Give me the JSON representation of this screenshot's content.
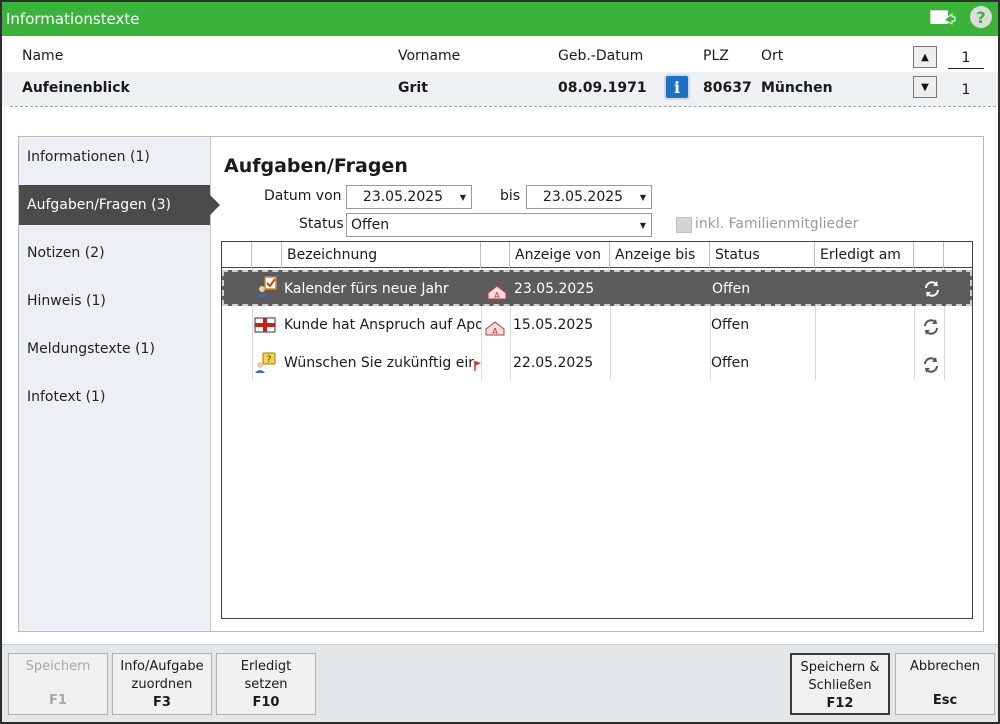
{
  "window": {
    "title": "Informationstexte"
  },
  "titlebar": {
    "exit_icon": "exit-window-icon",
    "help_icon": "help-icon",
    "help_glyph": "?"
  },
  "patient": {
    "labels": {
      "name": "Name",
      "vorname": "Vorname",
      "geb": "Geb.-Datum",
      "plz": "PLZ",
      "ort": "Ort"
    },
    "values": {
      "name": "Aufeinenblick",
      "vorname": "Grit",
      "geb": "08.09.1971",
      "plz": "80637",
      "ort": "München"
    },
    "info_glyph": "i",
    "pager": {
      "current": "1",
      "total": "1"
    }
  },
  "sidebar": {
    "items": [
      {
        "label": "Informationen (1)"
      },
      {
        "label": "Aufgaben/Fragen (3)",
        "active": true
      },
      {
        "label": "Notizen (2)"
      },
      {
        "label": "Hinweis (1)"
      },
      {
        "label": "Meldungstexte (1)"
      },
      {
        "label": "Infotext (1)"
      }
    ]
  },
  "content": {
    "title": "Aufgaben/Fragen",
    "filters": {
      "datum_von_label": "Datum von",
      "datum_von": "23.05.2025",
      "bis_label": "bis",
      "bis": "23.05.2025",
      "status_label": "Status",
      "status": "Offen",
      "family_label": "inkl. Familienmitglieder"
    },
    "table": {
      "headers": [
        "",
        "",
        "Bezeichnung",
        "",
        "Anzeige von",
        "Anzeige bis",
        "Status",
        "Erledigt am",
        ""
      ],
      "rows": [
        {
          "bezeichnung": "Kalender fürs neue Jahr",
          "anzeige_von": "23.05.2025",
          "anzeige_bis": "",
          "status": "Offen",
          "erledigt_am": "",
          "icon": "task-person-icon",
          "selected": true
        },
        {
          "bezeichnung": "Kunde hat Anspruch auf Apot",
          "anzeige_von": "15.05.2025",
          "anzeige_bis": "",
          "status": "Offen",
          "erledigt_am": "",
          "icon": "gift-card-icon",
          "selected": false
        },
        {
          "bezeichnung": "Wünschen Sie zukünftig eine",
          "anzeige_von": "22.05.2025",
          "anzeige_bis": "",
          "status": "Offen",
          "erledigt_am": "",
          "icon": "question-person-icon",
          "selected": false
        }
      ]
    }
  },
  "footer": {
    "buttons": [
      {
        "label": "Speichern",
        "key": "F1",
        "disabled": true
      },
      {
        "label": "Info/Aufgabe\nzuordnen",
        "key": "F3"
      },
      {
        "label": "Erledigt\nsetzen",
        "key": "F10"
      },
      {
        "label": "Speichern &\nSchließen",
        "key": "F12"
      },
      {
        "label": "Abbrechen",
        "key": "Esc"
      }
    ]
  },
  "colors": {
    "titlebar": "#3bb33b",
    "selected_row": "#5c5c5c",
    "info_button": "#1f6fc4"
  }
}
